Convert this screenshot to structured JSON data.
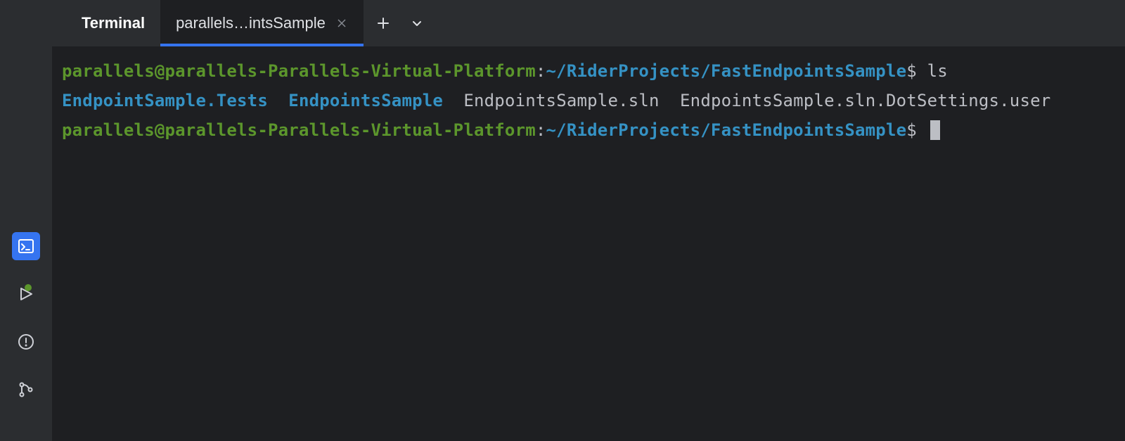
{
  "tabs": {
    "title": "Terminal",
    "active_tab_label": "parallels…intsSample"
  },
  "icons": {
    "terminal": "terminal-icon",
    "run": "run-icon",
    "problems": "problems-icon",
    "git": "git-icon",
    "plus": "plus-icon",
    "chevron_down": "chevron-down-icon",
    "close": "close-icon"
  },
  "terminal": {
    "lines": [
      {
        "prompt_user": "parallels@parallels-Parallels-Virtual-Platform",
        "prompt_sep": ":",
        "prompt_path": "~/RiderProjects/FastEndpointsSample",
        "prompt_dollar": "$",
        "command": "ls"
      },
      {
        "ls_output": [
          {
            "name": "EndpointSample.Tests",
            "type": "dir"
          },
          {
            "name": "EndpointsSample",
            "type": "dir"
          },
          {
            "name": "EndpointsSample.sln",
            "type": "file"
          },
          {
            "name": "EndpointsSample.sln.DotSettings.user",
            "type": "file"
          }
        ]
      },
      {
        "prompt_user": "parallels@parallels-Parallels-Virtual-Platform",
        "prompt_sep": ":",
        "prompt_path": "~/RiderProjects/FastEndpointsSample",
        "prompt_dollar": "$",
        "command": "",
        "cursor": true
      }
    ]
  },
  "colors": {
    "bg": "#1e1f22",
    "panel": "#2b2d30",
    "accent": "#3574f0",
    "green": "#5c962c",
    "blue": "#3592c4",
    "text": "#bcbec4"
  }
}
